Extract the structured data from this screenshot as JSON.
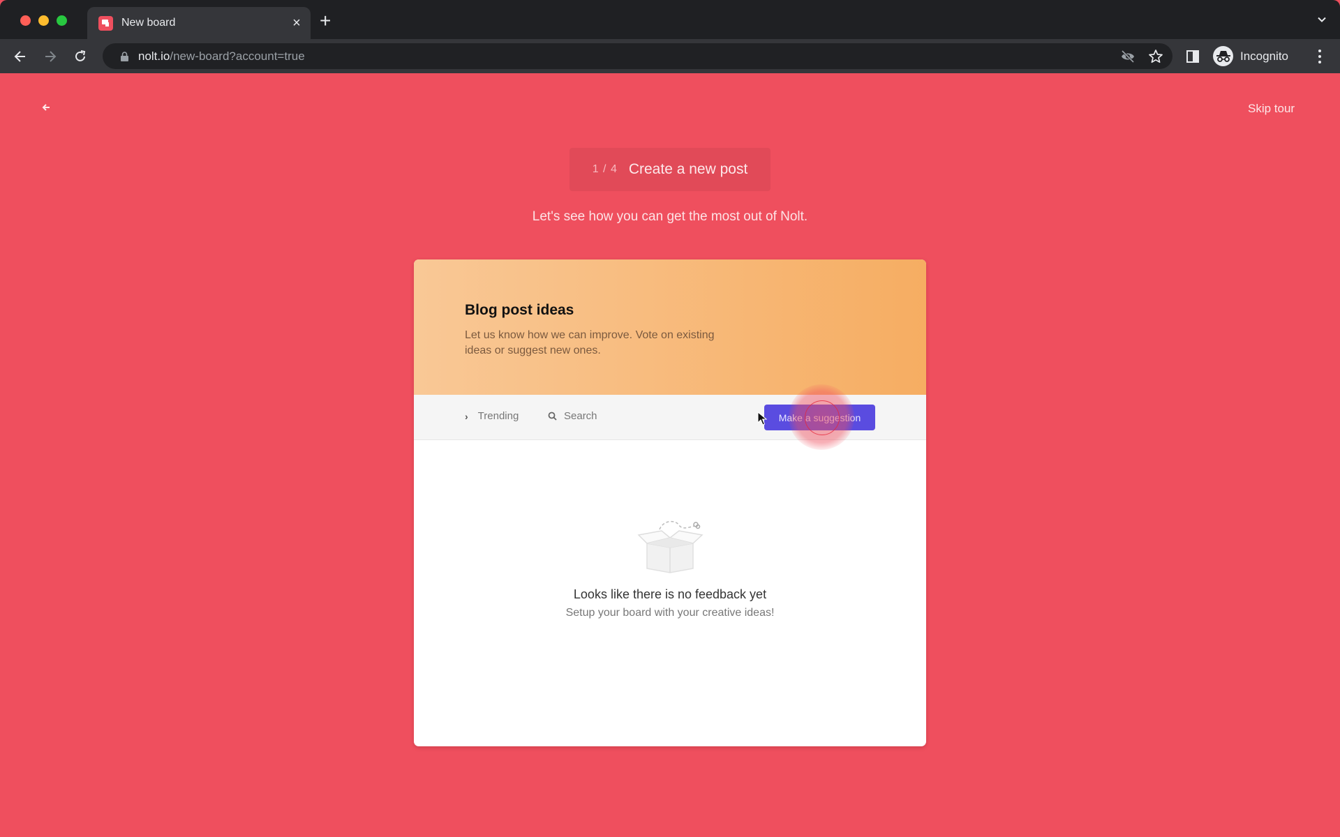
{
  "browser": {
    "tab": {
      "title": "New board",
      "favicon": "nolt-logo-icon"
    },
    "address_bar": {
      "host": "nolt.io",
      "path": "/new-board?account=true",
      "secure_icon": "lock-icon"
    },
    "toolbar_icons": [
      "back-icon",
      "forward-icon",
      "reload-icon",
      "eye-off-icon",
      "star-icon",
      "side-panel-icon",
      "menu-icon"
    ],
    "profile": {
      "label": "Incognito",
      "icon": "incognito-icon"
    }
  },
  "page": {
    "skip_tour": "Skip tour",
    "step": {
      "current": "1",
      "total": "4",
      "count_label": "1 / 4",
      "title": "Create a new post"
    },
    "subtitle": "Let's see how you can get the most out of Nolt.",
    "colors": {
      "background": "#ef4f5e",
      "primary_button": "#5a4ce0",
      "header_gradient_start": "#f9c896",
      "header_gradient_end": "#f6ad62"
    },
    "board": {
      "title": "Blog post ideas",
      "description": "Let us know how we can improve. Vote on existing ideas or suggest new ones.",
      "sort_label": "Trending",
      "search_placeholder": "Search",
      "suggest_button": "Make a suggestion",
      "empty_state": {
        "title": "Looks like there is no feedback yet",
        "subtitle": "Setup your board with your creative ideas!",
        "icon": "empty-box-icon"
      }
    }
  }
}
